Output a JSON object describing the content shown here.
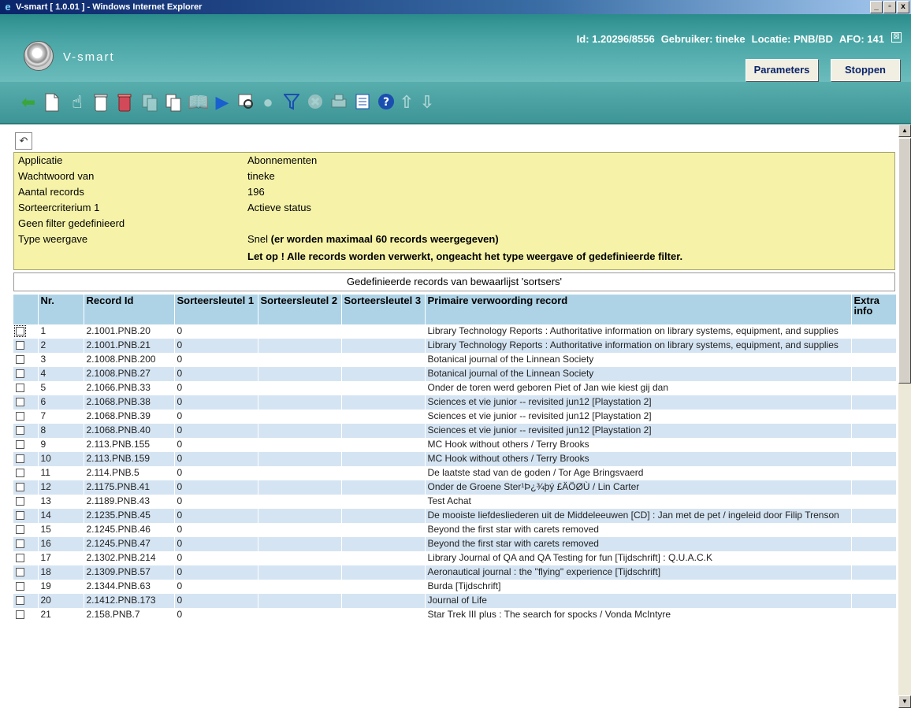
{
  "window": {
    "title": "V-smart [ 1.0.01 ] - Windows Internet Explorer",
    "min_btn": "_",
    "max_btn": "▫",
    "close_btn": "x"
  },
  "header": {
    "brand": "V-smart",
    "id_text": "Id: 1.20296/8556",
    "user_text": "Gebruiker: tineke",
    "locatie_text": "Locatie: PNB/BD",
    "afo_text": "AFO: 141",
    "close_icon": "⊠",
    "parameters_label": "Parameters",
    "stoppen_label": "Stoppen"
  },
  "toolbar": {
    "icons": [
      "back-arrow-icon",
      "new-document-icon",
      "select-hand-icon",
      "delete-icon",
      "delete-all-icon",
      "copy-record-icon",
      "copy-icon",
      "open-book-icon",
      "play-icon",
      "search-settings-icon",
      "chat-icon",
      "filter-icon",
      "clear-filter-icon",
      "print-icon",
      "list-icon",
      "help-icon",
      "up-arrow-icon",
      "down-arrow-icon"
    ]
  },
  "info": {
    "rows": [
      {
        "label": "Applicatie",
        "value": "Abonnementen"
      },
      {
        "label": "Wachtwoord van",
        "value": "tineke"
      },
      {
        "label": "Aantal records",
        "value": "196"
      },
      {
        "label": "Sorteercriterium 1",
        "value": "Actieve status"
      },
      {
        "label": "Geen filter gedefinieerd",
        "value": ""
      },
      {
        "label": "Type weergave",
        "value": "Snel"
      }
    ],
    "type_extra": "(er worden maximaal 60 records weergegeven)",
    "warning": "Let op ! Alle records worden verwerkt, ongeacht het type weergave of gedefinieerde filter."
  },
  "subtitle": "Gedefinieerde records van bewaarlijst 'sortsers'",
  "table": {
    "headers": [
      "",
      "Nr.",
      "Record Id",
      "Sorteersleutel 1",
      "Sorteersleutel 2",
      "Sorteersleutel 3",
      "Primaire verwoording record",
      "Extra info"
    ],
    "rows": [
      [
        "1",
        "2.1001.PNB.20",
        "0",
        "",
        "",
        "Library Technology Reports : Authoritative information on library systems, equipment, and supplies",
        ""
      ],
      [
        "2",
        "2.1001.PNB.21",
        "0",
        "",
        "",
        "Library Technology Reports : Authoritative information on library systems, equipment, and supplies",
        ""
      ],
      [
        "3",
        "2.1008.PNB.200",
        "0",
        "",
        "",
        "Botanical journal of the Linnean Society",
        ""
      ],
      [
        "4",
        "2.1008.PNB.27",
        "0",
        "",
        "",
        "Botanical journal of the Linnean Society",
        ""
      ],
      [
        "5",
        "2.1066.PNB.33",
        "0",
        "",
        "",
        "Onder de toren werd geboren Piet of Jan wie kiest gij dan",
        ""
      ],
      [
        "6",
        "2.1068.PNB.38",
        "0",
        "",
        "",
        "Sciences et vie junior -- revisited jun12 [Playstation 2]",
        ""
      ],
      [
        "7",
        "2.1068.PNB.39",
        "0",
        "",
        "",
        "Sciences et vie junior -- revisited jun12 [Playstation 2]",
        ""
      ],
      [
        "8",
        "2.1068.PNB.40",
        "0",
        "",
        "",
        "Sciences et vie junior -- revisited jun12 [Playstation 2]",
        ""
      ],
      [
        "9",
        "2.113.PNB.155",
        "0",
        "",
        "",
        "MC Hook without others / Terry Brooks",
        ""
      ],
      [
        "10",
        "2.113.PNB.159",
        "0",
        "",
        "",
        "MC Hook without others / Terry Brooks",
        ""
      ],
      [
        "11",
        "2.114.PNB.5",
        "0",
        "",
        "",
        "De laatste stad van de goden / Tor Age Bringsvaerd",
        ""
      ],
      [
        "12",
        "2.1175.PNB.41",
        "0",
        "",
        "",
        "Onder de Groene Ster¹Þ¿¾þý £ÄÖØÙ / Lin Carter",
        ""
      ],
      [
        "13",
        "2.1189.PNB.43",
        "0",
        "",
        "",
        "Test Achat",
        ""
      ],
      [
        "14",
        "2.1235.PNB.45",
        "0",
        "",
        "",
        "De mooiste liefdesliederen uit de Middeleeuwen [CD] : Jan met de pet / ingeleid door Filip Trenson",
        ""
      ],
      [
        "15",
        "2.1245.PNB.46",
        "0",
        "",
        "",
        "Beyond the first star with carets removed",
        ""
      ],
      [
        "16",
        "2.1245.PNB.47",
        "0",
        "",
        "",
        "Beyond the first star with carets removed",
        ""
      ],
      [
        "17",
        "2.1302.PNB.214",
        "0",
        "",
        "",
        "Library Journal of QA and QA Testing for fun [Tijdschrift] : Q.U.A.C.K",
        ""
      ],
      [
        "18",
        "2.1309.PNB.57",
        "0",
        "",
        "",
        "Aeronautical journal : the \"flying\" experience [Tijdschrift]",
        ""
      ],
      [
        "19",
        "2.1344.PNB.63",
        "0",
        "",
        "",
        "Burda [Tijdschrift]",
        ""
      ],
      [
        "20",
        "2.1412.PNB.173",
        "0",
        "",
        "",
        "Journal of Life",
        ""
      ],
      [
        "21",
        "2.158.PNB.7",
        "0",
        "",
        "",
        "Star Trek III plus : The search for spocks / Vonda McIntyre",
        ""
      ]
    ]
  }
}
